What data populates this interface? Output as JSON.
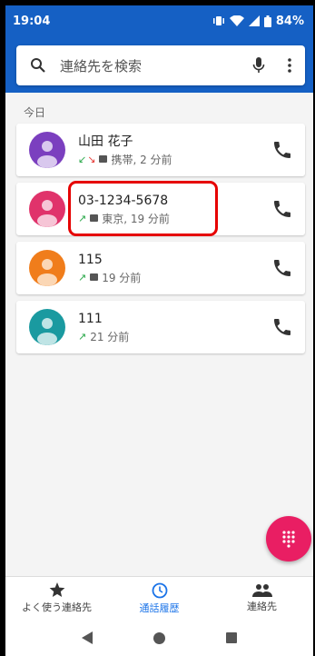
{
  "status": {
    "time": "19:04",
    "battery": "84%"
  },
  "search": {
    "placeholder": "連絡先を検索"
  },
  "section": {
    "today_label": "今日"
  },
  "calls": [
    {
      "name": "山田 花子",
      "detail": "携帯, 2 分前",
      "avatar_color": "#7b3fbf",
      "arrows": "↙ ↘"
    },
    {
      "name": "03-1234-5678",
      "detail": "東京, 19 分前",
      "avatar_color": "#e0336b",
      "arrows": "↗"
    },
    {
      "name": "115",
      "detail": "19 分前",
      "avatar_color": "#f07d1b",
      "arrows": "↗"
    },
    {
      "name": "111",
      "detail": "21 分前",
      "avatar_color": "#1a9aa0",
      "arrows": "↗"
    }
  ],
  "nav": {
    "favorites": "よく使う連絡先",
    "recents": "通話履歴",
    "contacts": "連絡先"
  },
  "colors": {
    "accent": "#1560c4",
    "active_tab": "#1a73e8",
    "fab": "#e91e63",
    "highlight": "#e60000"
  }
}
